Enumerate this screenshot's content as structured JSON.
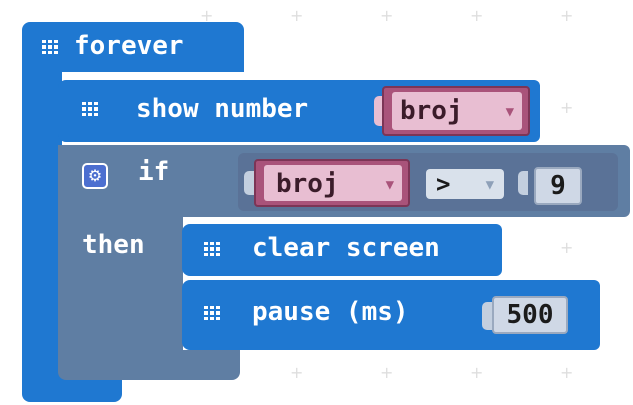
{
  "blocks": {
    "forever": {
      "label": "forever"
    },
    "show_number": {
      "label": "show number",
      "variable": "broj"
    },
    "if_block": {
      "if_label": "if",
      "then_label": "then"
    },
    "condition": {
      "left_variable": "broj",
      "operator": ">",
      "right_value": "9"
    },
    "clear_screen": {
      "label": "clear screen"
    },
    "pause": {
      "label": "pause (ms)",
      "value": "500"
    }
  },
  "icons": {
    "block_icon": "grid-icon",
    "if_settings": "gear-icon",
    "dropdown": "chevron-down-icon"
  },
  "colors": {
    "basic_block": "#1f78d1",
    "logic_block": "#5f7ea3",
    "variable_block": "#a9537a",
    "variable_field": "#e8bed2",
    "number_field": "#cfd8e6"
  }
}
